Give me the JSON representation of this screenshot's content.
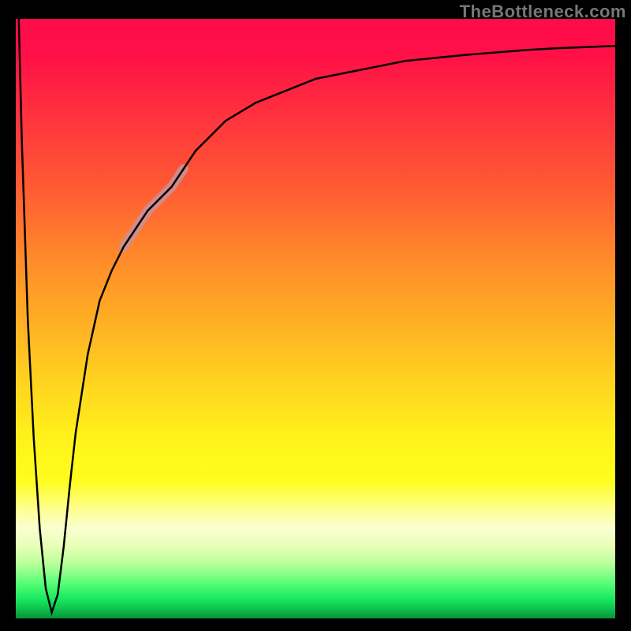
{
  "watermark": "TheBottleneck.com",
  "chart_data": {
    "type": "line",
    "title": "",
    "xlabel": "",
    "ylabel": "",
    "xlim": [
      0,
      100
    ],
    "ylim": [
      0,
      100
    ],
    "grid": false,
    "legend": false,
    "gradient_bands": [
      {
        "y_percent": 0,
        "color": "#ff0a4b"
      },
      {
        "y_percent": 15,
        "color": "#ff2e3f"
      },
      {
        "y_percent": 40,
        "color": "#ff8a2a"
      },
      {
        "y_percent": 62,
        "color": "#ffd81f"
      },
      {
        "y_percent": 77,
        "color": "#fffe1c"
      },
      {
        "y_percent": 85,
        "color": "#f9ffd0"
      },
      {
        "y_percent": 94,
        "color": "#5aff78"
      },
      {
        "y_percent": 100,
        "color": "#07963a"
      }
    ],
    "series": [
      {
        "name": "bottleneck_curve",
        "color": "#000000",
        "x": [
          0.5,
          1,
          2,
          3,
          4,
          5,
          6,
          7,
          8,
          9,
          10,
          12,
          14,
          16,
          18,
          20,
          22,
          24,
          26,
          28,
          30,
          35,
          40,
          45,
          50,
          55,
          60,
          65,
          70,
          75,
          80,
          85,
          90,
          95,
          100
        ],
        "y": [
          100,
          80,
          50,
          30,
          15,
          5,
          1,
          4,
          12,
          22,
          31,
          44,
          53,
          58,
          62,
          65,
          68,
          70,
          72,
          75,
          78,
          83,
          86,
          88,
          90,
          91,
          92,
          93,
          93.5,
          94,
          94.4,
          94.8,
          95.1,
          95.3,
          95.5
        ]
      },
      {
        "name": "highlight_segment",
        "color": "#c99199",
        "thickness": 12,
        "x": [
          18,
          20,
          22,
          24,
          26,
          28
        ],
        "y": [
          62,
          65,
          68,
          70,
          72,
          75
        ]
      }
    ],
    "annotations": []
  }
}
